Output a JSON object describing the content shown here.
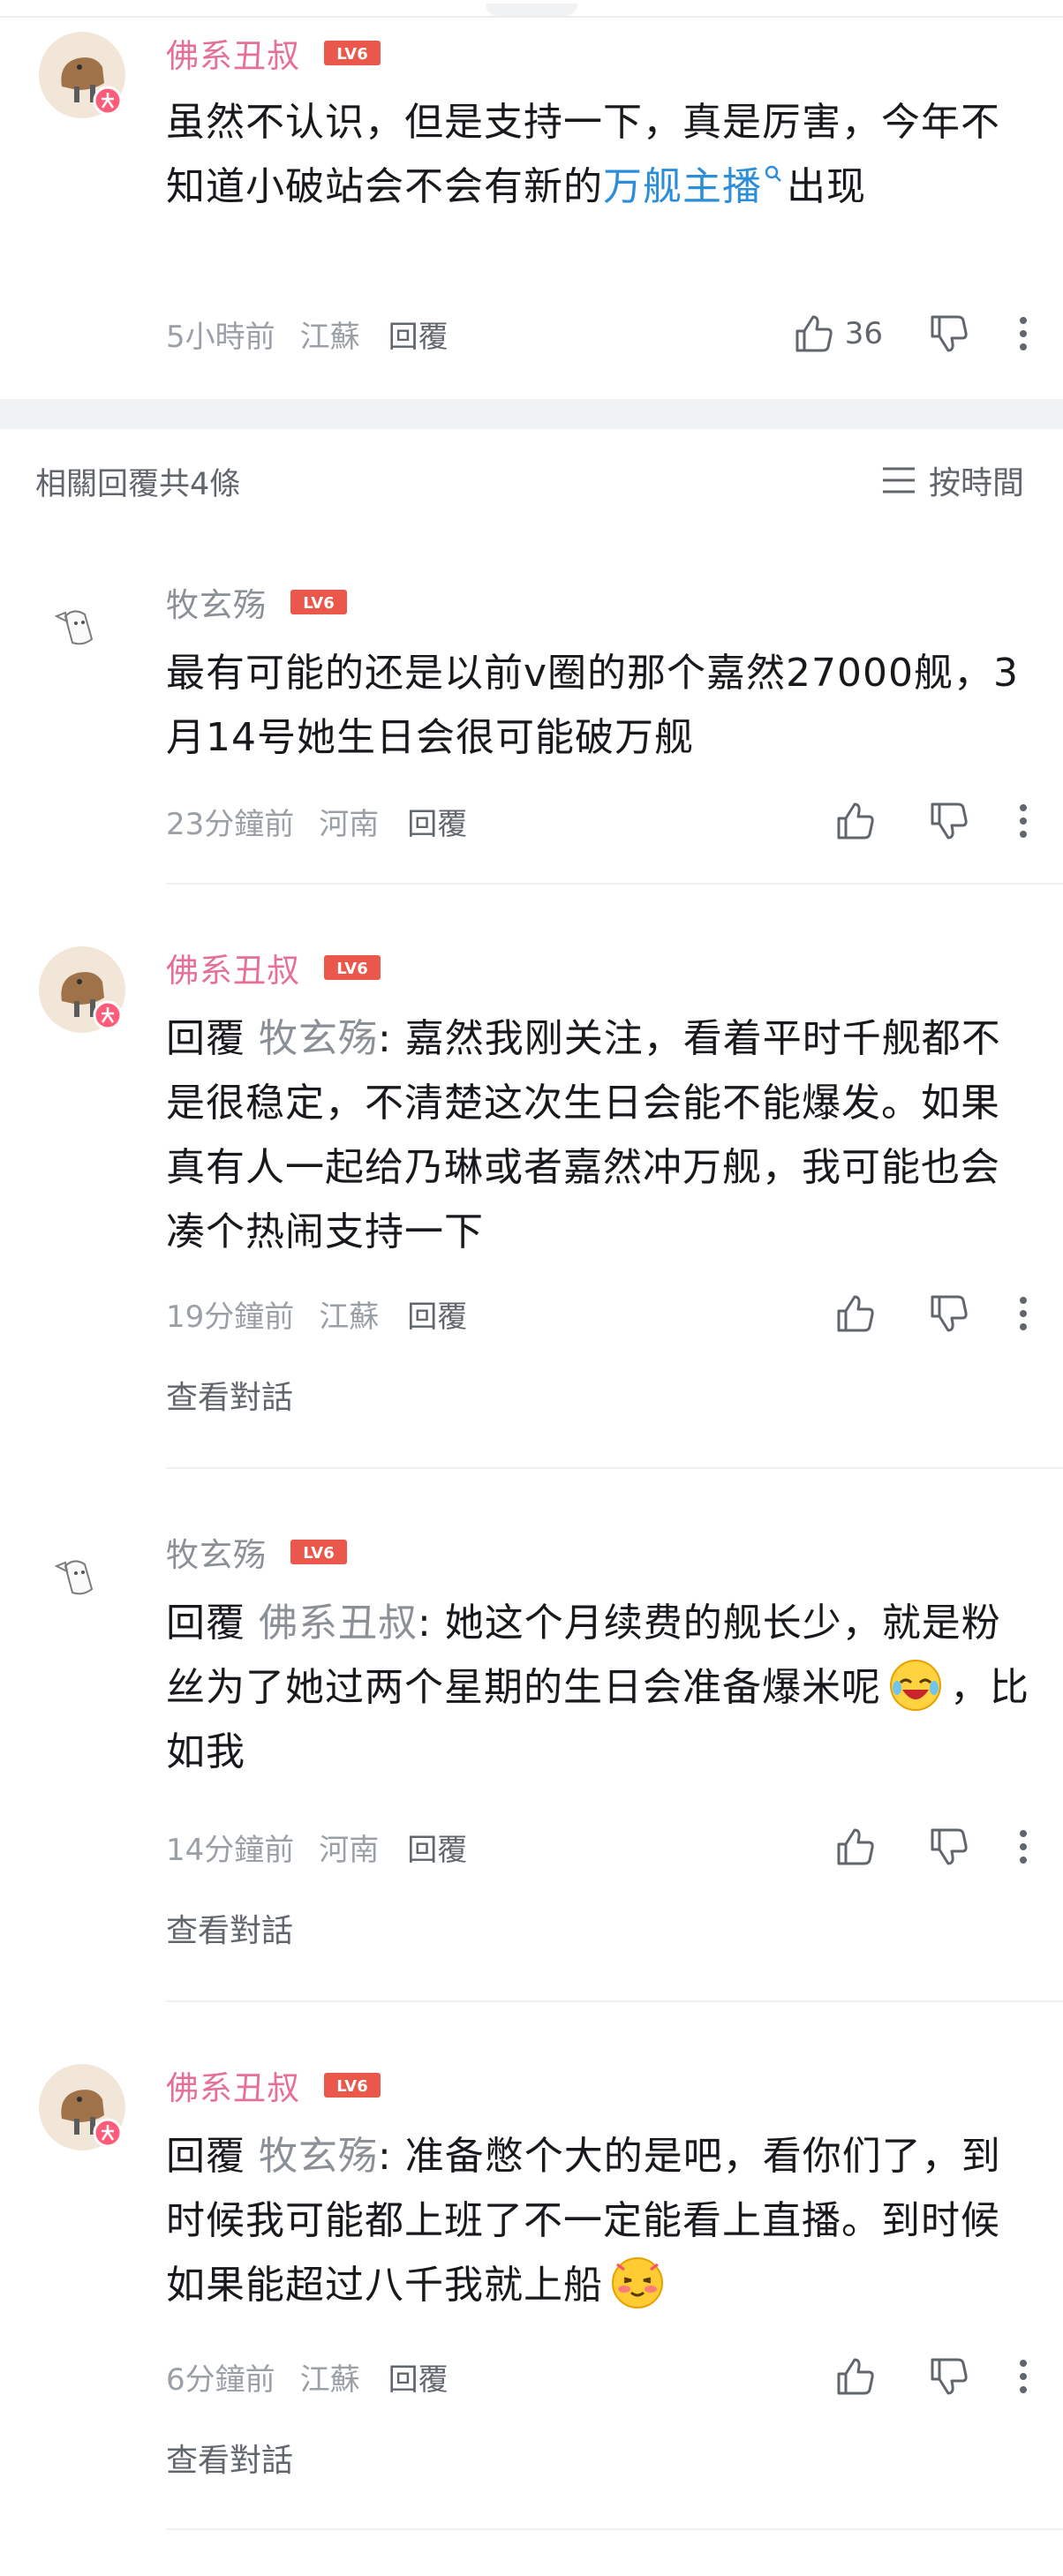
{
  "root_comment": {
    "username": "佛系丑叔",
    "level": "LV6",
    "text_before": "虽然不认识，但是支持一下，真是厉害，今年不知道小破站会不会有新的",
    "link_text": "万舰主播",
    "text_after": "出现",
    "time": "5小時前",
    "location": "江蘇",
    "reply_label": "回覆",
    "like_count": "36"
  },
  "section": {
    "title": "相關回覆共4條",
    "sort_label": "按時間"
  },
  "replies": [
    {
      "username": "牧玄殇",
      "level": "LV6",
      "text": "最有可能的还是以前v圈的那个嘉然27000舰，3月14号她生日会很可能破万舰",
      "time": "23分鐘前",
      "location": "河南",
      "reply_label": "回覆"
    },
    {
      "username": "佛系丑叔",
      "level": "LV6",
      "reply_prefix": "回覆",
      "reply_target": "牧玄殇",
      "text": ": 嘉然我刚关注，看着平时千舰都不是很稳定，不清楚这次生日会能不能爆发。如果真有人一起给乃琳或者嘉然冲万舰，我可能也会凑个热闹支持一下",
      "time": "19分鐘前",
      "location": "江蘇",
      "reply_label": "回覆",
      "view_conversation": "查看對話"
    },
    {
      "username": "牧玄殇",
      "level": "LV6",
      "reply_prefix": "回覆",
      "reply_target": "佛系丑叔",
      "text": ": 她这个月续费的舰长少，就是粉丝为了她过两个星期的生日会准备爆米呢",
      "text_after_emoji": "，比如我",
      "time": "14分鐘前",
      "location": "河南",
      "reply_label": "回覆",
      "view_conversation": "查看對話"
    },
    {
      "username": "佛系丑叔",
      "level": "LV6",
      "reply_prefix": "回覆",
      "reply_target": "牧玄殇",
      "text": ": 准备憋个大的是吧，看你们了，到时候我可能都上班了不一定能看上直播。到时候如果能超过八千我就上船",
      "time": "6分鐘前",
      "location": "江蘇",
      "reply_label": "回覆",
      "view_conversation": "查看對話"
    }
  ],
  "colors": {
    "vip_name": "#e56f98",
    "level_badge": "#e9584b",
    "link": "#2c8ed8",
    "meta_text": "#9aa0a6"
  },
  "icons": [
    "like-icon",
    "dislike-icon",
    "more-icon",
    "search-icon",
    "sort-list-icon",
    "level-badge"
  ]
}
